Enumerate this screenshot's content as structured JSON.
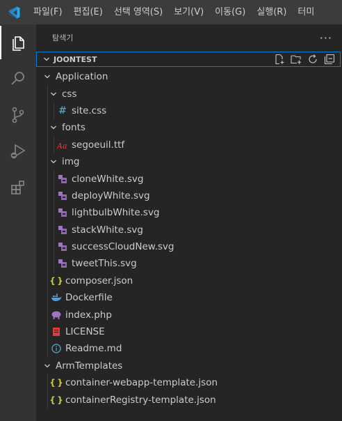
{
  "menubar": {
    "items": [
      "파일(F)",
      "편집(E)",
      "선택 영역(S)",
      "보기(V)",
      "이동(G)",
      "실행(R)",
      "터미"
    ]
  },
  "sidebar": {
    "title": "탐색기",
    "more": "···",
    "section_title": "JOONTEST"
  },
  "tree": [
    {
      "label": "Application",
      "depth": 0,
      "type": "folder",
      "expanded": true
    },
    {
      "label": "css",
      "depth": 1,
      "type": "folder",
      "expanded": true
    },
    {
      "label": "site.css",
      "depth": 2,
      "type": "file",
      "icon": "hash-icon"
    },
    {
      "label": "fonts",
      "depth": 1,
      "type": "folder",
      "expanded": true
    },
    {
      "label": "segoeuil.ttf",
      "depth": 2,
      "type": "file",
      "icon": "font-icon"
    },
    {
      "label": "img",
      "depth": 1,
      "type": "folder",
      "expanded": true
    },
    {
      "label": "cloneWhite.svg",
      "depth": 2,
      "type": "file",
      "icon": "svg-icon"
    },
    {
      "label": "deployWhite.svg",
      "depth": 2,
      "type": "file",
      "icon": "svg-icon"
    },
    {
      "label": "lightbulbWhite.svg",
      "depth": 2,
      "type": "file",
      "icon": "svg-icon"
    },
    {
      "label": "stackWhite.svg",
      "depth": 2,
      "type": "file",
      "icon": "svg-icon"
    },
    {
      "label": "successCloudNew.svg",
      "depth": 2,
      "type": "file",
      "icon": "svg-icon"
    },
    {
      "label": "tweetThis.svg",
      "depth": 2,
      "type": "file",
      "icon": "svg-icon"
    },
    {
      "label": "composer.json",
      "depth": 1,
      "type": "file",
      "icon": "json-icon"
    },
    {
      "label": "Dockerfile",
      "depth": 1,
      "type": "file",
      "icon": "docker-icon"
    },
    {
      "label": "index.php",
      "depth": 1,
      "type": "file",
      "icon": "php-icon"
    },
    {
      "label": "LICENSE",
      "depth": 1,
      "type": "file",
      "icon": "license-icon"
    },
    {
      "label": "Readme.md",
      "depth": 1,
      "type": "file",
      "icon": "info-icon"
    },
    {
      "label": "ArmTemplates",
      "depth": 0,
      "type": "folder",
      "expanded": true
    },
    {
      "label": "container-webapp-template.json",
      "depth": 1,
      "type": "file",
      "icon": "json-icon"
    },
    {
      "label": "containerRegistry-template.json",
      "depth": 1,
      "type": "file",
      "icon": "json-icon"
    }
  ],
  "colors": {
    "accent": "#007fd4",
    "vscode_blue": "#23a9f2",
    "json": "#cbcb41",
    "css_hash": "#519aba",
    "svg": "#a074c4",
    "font": "#e03c3c",
    "docker": "#4f9cd9",
    "php": "#a074c4",
    "license": "#e03c3c",
    "info": "#519aba"
  }
}
